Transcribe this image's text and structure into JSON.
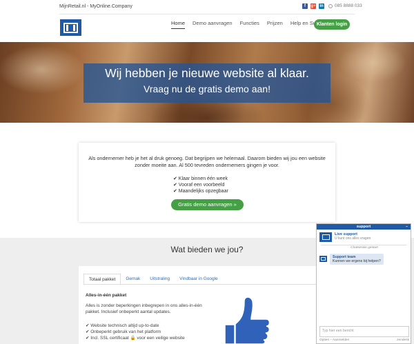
{
  "topbar": {
    "brand": "MijnRetail.nl - MyOnline.Company",
    "social": [
      {
        "icon": "facebook-icon",
        "glyph": "f",
        "color": "#3b5998"
      },
      {
        "icon": "google-plus-icon",
        "glyph": "g+",
        "color": "#dd4b39"
      },
      {
        "icon": "linkedin-icon",
        "glyph": "in",
        "color": "#0e76a8"
      }
    ],
    "phone": "085 8888 033"
  },
  "nav": {
    "items": [
      "Home",
      "Demo aanvragen",
      "Functies",
      "Prijzen",
      "Help en Support"
    ],
    "active": "Home",
    "login_label": "Klanten login"
  },
  "hero": {
    "title": "Wij hebben je nieuwe website al klaar.",
    "subtitle": "Vraag nu de gratis demo aan!"
  },
  "intro": {
    "text": "Als ondernemer heb je het al druk genoeg. Dat begrijpen we helemaal. Daarom bieden wij jou een website zonder moeite aan. Al 500 tevreden ondernemers gingen je voor.",
    "checks": [
      "✔ Klaar binnen één week",
      "✔ Vooraf een voorbeeld",
      "✔ Maandelijks opzegbaar"
    ],
    "button_label": "Gratis demo aanvragen »"
  },
  "offer": {
    "title": "Wat bieden we jou?",
    "tabs": [
      "Totaal pakket",
      "Gemak",
      "Uitstraling",
      "Vindbaar in Google"
    ],
    "active_tab": "Totaal pakket",
    "package_title": "Alles-in-één pakket",
    "package_desc": "Alles is zonder beperkingen inbegrepen in ons alles-in-één pakket. Inclusief onbeperkt aantal updates.",
    "package_list": [
      "✔ Website technisch altijd up-to-date",
      "✔ Onbeperkt gebruik van het platform",
      "✔ Incl. SSL certificaat 🔒 voor een veilige website"
    ]
  },
  "chat": {
    "header": "support",
    "minimize": "–",
    "agent_name": "Live support",
    "agent_sub": "U kunt ons alles vragen",
    "started": "Chatsessie gestart",
    "message_author": "Support team",
    "message_text": "Kunnen we ergens bij helpen?",
    "input_placeholder": "Typ hier een bericht",
    "footer_left": "Opties – Aanmelden",
    "footer_right": "zendesk"
  },
  "colors": {
    "brand_blue": "#1e5aa6",
    "button_green": "#45a045",
    "link_blue": "#2a6cc0"
  }
}
